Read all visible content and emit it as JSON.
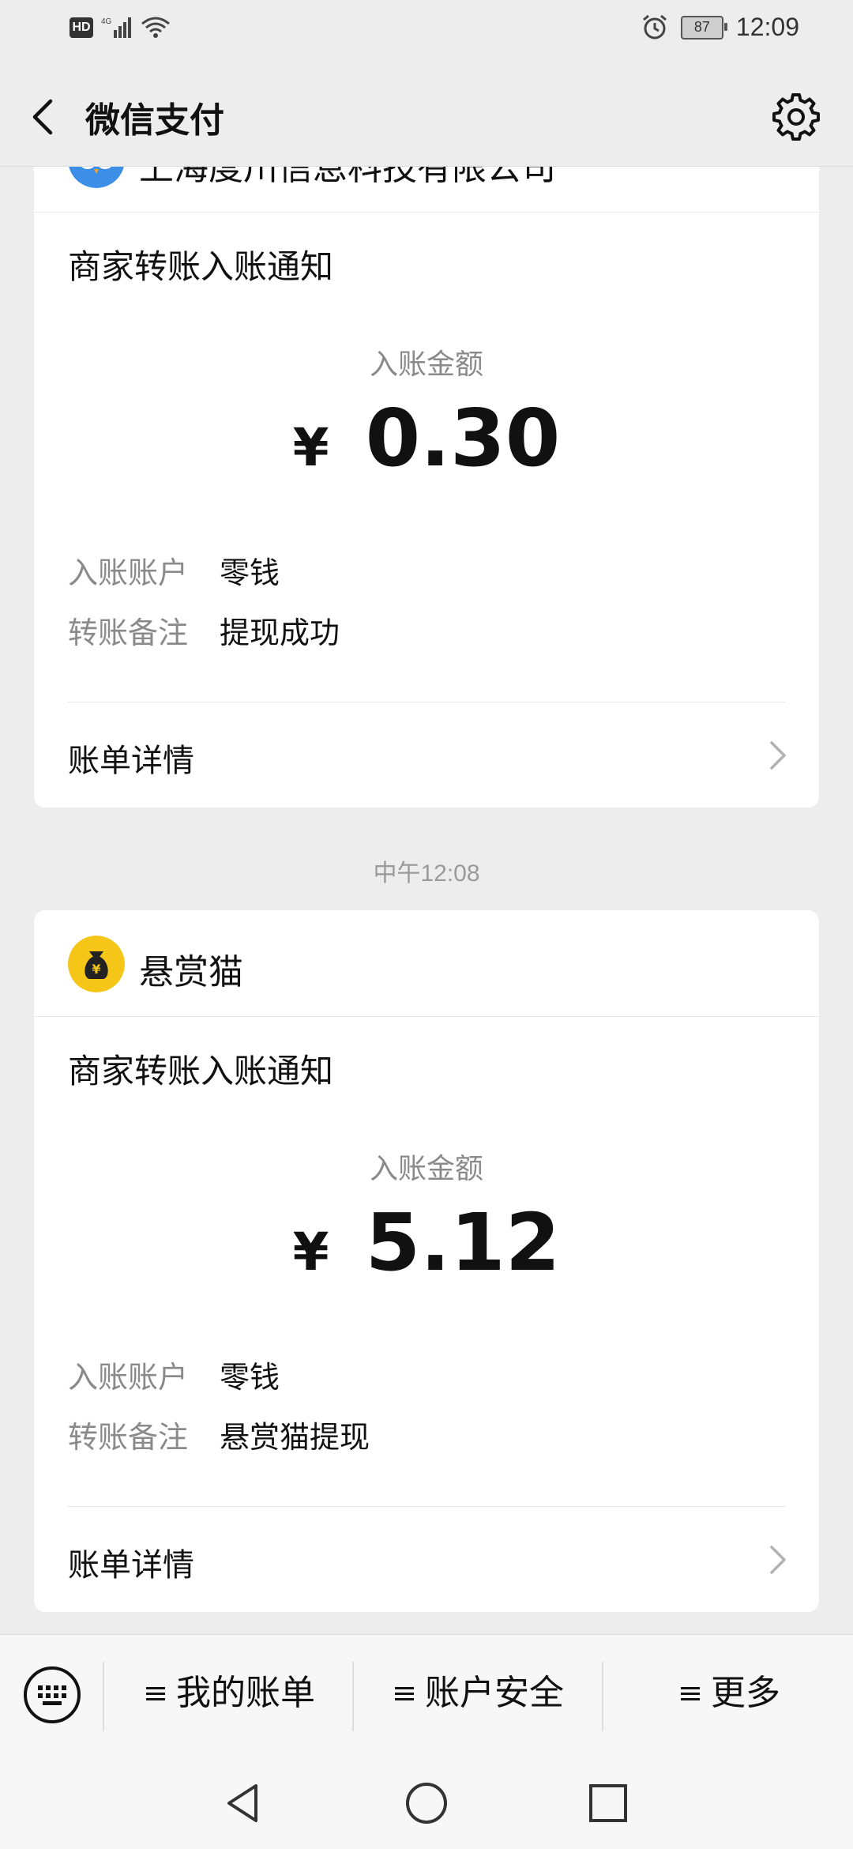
{
  "status_bar": {
    "hd": "HD",
    "network": "4G",
    "battery": "87",
    "time": "12:09"
  },
  "nav": {
    "title": "微信支付"
  },
  "cards": [
    {
      "brand": "上海度川信息科技有限公司",
      "notice_title": "商家转账入账通知",
      "amount_label": "入账金额",
      "currency": "¥",
      "amount": "0.30",
      "account_key": "入账账户",
      "account_val": "零钱",
      "remark_key": "转账备注",
      "remark_val": "提现成功",
      "detail_label": "账单详情"
    },
    {
      "brand": "悬赏猫",
      "notice_title": "商家转账入账通知",
      "amount_label": "入账金额",
      "currency": "¥",
      "amount": "5.12",
      "account_key": "入账账户",
      "account_val": "零钱",
      "remark_key": "转账备注",
      "remark_val": "悬赏猫提现",
      "detail_label": "账单详情"
    }
  ],
  "timestamp": "中午12:08",
  "menu": {
    "items": [
      "我的账单",
      "账户安全",
      "更多"
    ]
  },
  "colors": {
    "background": "#ededed",
    "logo_blue": "#3c8ee6",
    "logo_yellow": "#f5c518"
  }
}
